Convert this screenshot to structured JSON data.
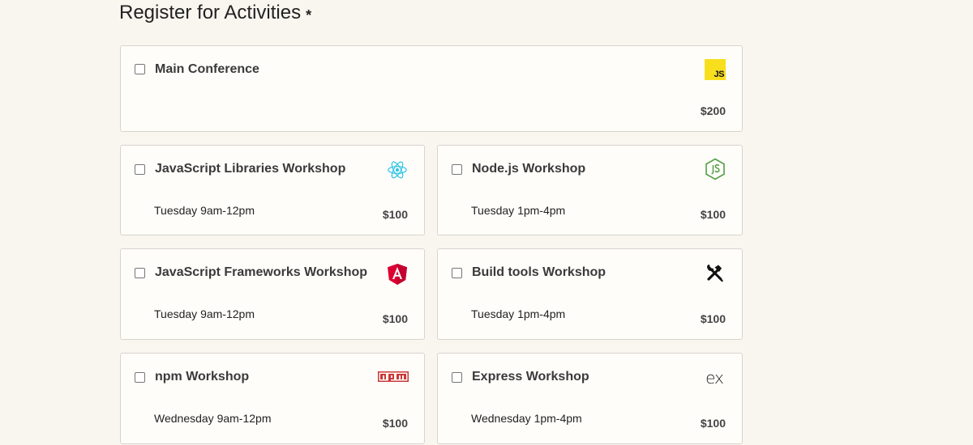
{
  "heading": {
    "text": "Register for Activities",
    "required_marker": "*"
  },
  "activities": [
    {
      "id": "main-conference",
      "name": "Main Conference",
      "time": "",
      "price": "$200",
      "icon": "javascript-icon",
      "checked": false
    },
    {
      "id": "js-libraries",
      "name": "JavaScript Libraries Workshop",
      "time": "Tuesday 9am-12pm",
      "price": "$100",
      "icon": "react-icon",
      "checked": false
    },
    {
      "id": "node",
      "name": "Node.js Workshop",
      "time": "Tuesday 1pm-4pm",
      "price": "$100",
      "icon": "nodejs-icon",
      "checked": false
    },
    {
      "id": "js-frameworks",
      "name": "JavaScript Frameworks Workshop",
      "time": "Tuesday 9am-12pm",
      "price": "$100",
      "icon": "angular-icon",
      "checked": false
    },
    {
      "id": "build-tools",
      "name": "Build tools Workshop",
      "time": "Tuesday 1pm-4pm",
      "price": "$100",
      "icon": "tools-icon",
      "checked": false
    },
    {
      "id": "npm",
      "name": "npm Workshop",
      "time": "Wednesday 9am-12pm",
      "price": "$100",
      "icon": "npm-icon",
      "checked": false
    },
    {
      "id": "express",
      "name": "Express Workshop",
      "time": "Wednesday 1pm-4pm",
      "price": "$100",
      "icon": "express-icon",
      "checked": false
    }
  ],
  "icon_texts": {
    "js": "JS",
    "express": "ex"
  },
  "colors": {
    "page_background": "#f9f5ef",
    "card_background": "#fefdfa",
    "card_border": "#d9d4cc",
    "js_yellow": "#f7df1e",
    "react_blue": "#2ec4e6",
    "node_green": "#539e43",
    "angular_red": "#dd0031",
    "npm_red": "#cb3837"
  }
}
